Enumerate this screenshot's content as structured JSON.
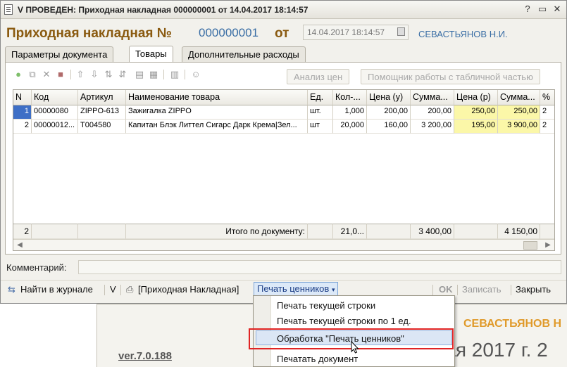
{
  "window": {
    "title": "V ПРОВЕДЕН: Приходная накладная 000000001 от 14.04.2017 18:14:57"
  },
  "header": {
    "doc_label": "Приходная накладная №",
    "doc_number": "000000001",
    "from_label": "от",
    "date_value": "14.04.2017 18:14:57",
    "author": "СЕВАСТЬЯНОВ Н.И."
  },
  "tabs": [
    {
      "label": "Параметры документа",
      "active": false
    },
    {
      "label": "Товары",
      "active": true
    },
    {
      "label": "Дополнительные расходы",
      "active": false
    }
  ],
  "toolbar": {
    "buttons": [
      "add-icon",
      "copy-icon",
      "delete-icon",
      "edit-icon",
      "move-up-icon",
      "move-down-icon",
      "sort-asc-icon",
      "sort-desc-icon",
      "table-icon",
      "columns-icon",
      "barcode-icon",
      "user-search-icon"
    ],
    "analysis_label": "Анализ цен",
    "helper_label": "Помощник работы с табличной частью"
  },
  "grid": {
    "headers": [
      "N",
      "Код",
      "Артикул",
      "Наименование товара",
      "Ед.",
      "Кол-...",
      "Цена (у)",
      "Сумма...",
      "Цена (р)",
      "Сумма...",
      "%"
    ],
    "rows": [
      [
        "1",
        "00000080",
        "ZIPPO-613",
        "Зажигалка ZIPPO",
        "шт.",
        "1,000",
        "200,00",
        "200,00",
        "250,00",
        "250,00",
        "2"
      ],
      [
        "2",
        "00000012...",
        "T004580",
        "Капитан Блэк Литтел Сигарс Дарк Крема|Зел...",
        "шт",
        "20,000",
        "160,00",
        "3 200,00",
        "195,00",
        "3 900,00",
        "2"
      ]
    ],
    "footer": {
      "count": "2",
      "total_label": "Итого по документу:",
      "qty_total": "21,0...",
      "sum_total": "3 400,00",
      "sum_total_r": "4 150,00"
    }
  },
  "comment": {
    "label": "Комментарий:",
    "value": ""
  },
  "bottombar": {
    "find_in_journal": "Найти в журнале",
    "v_label": "V",
    "print_invoice": "[Приходная Накладная]",
    "print_tags": "Печать ценников",
    "ok": "OK",
    "write": "Записать",
    "close": "Закрыть"
  },
  "menu": {
    "items": [
      "Печать текущей строки",
      "Печать текущей строки по 1 ед.",
      "Обработка \"Печать ценников\"",
      "Печатать документ"
    ],
    "highlighted_index": 2
  },
  "background": {
    "user_name": "СЕВАСТЬЯНОВ Н",
    "version": "ver.7.0.188",
    "date_text": "мая 2017 г. 2"
  },
  "colors": {
    "title_orange": "#8a5a10",
    "link_blue": "#3a6ea5",
    "selection_blue": "#3e6fc6",
    "highlight_yellow": "#fbf7a8",
    "callout_red": "#e02424"
  }
}
